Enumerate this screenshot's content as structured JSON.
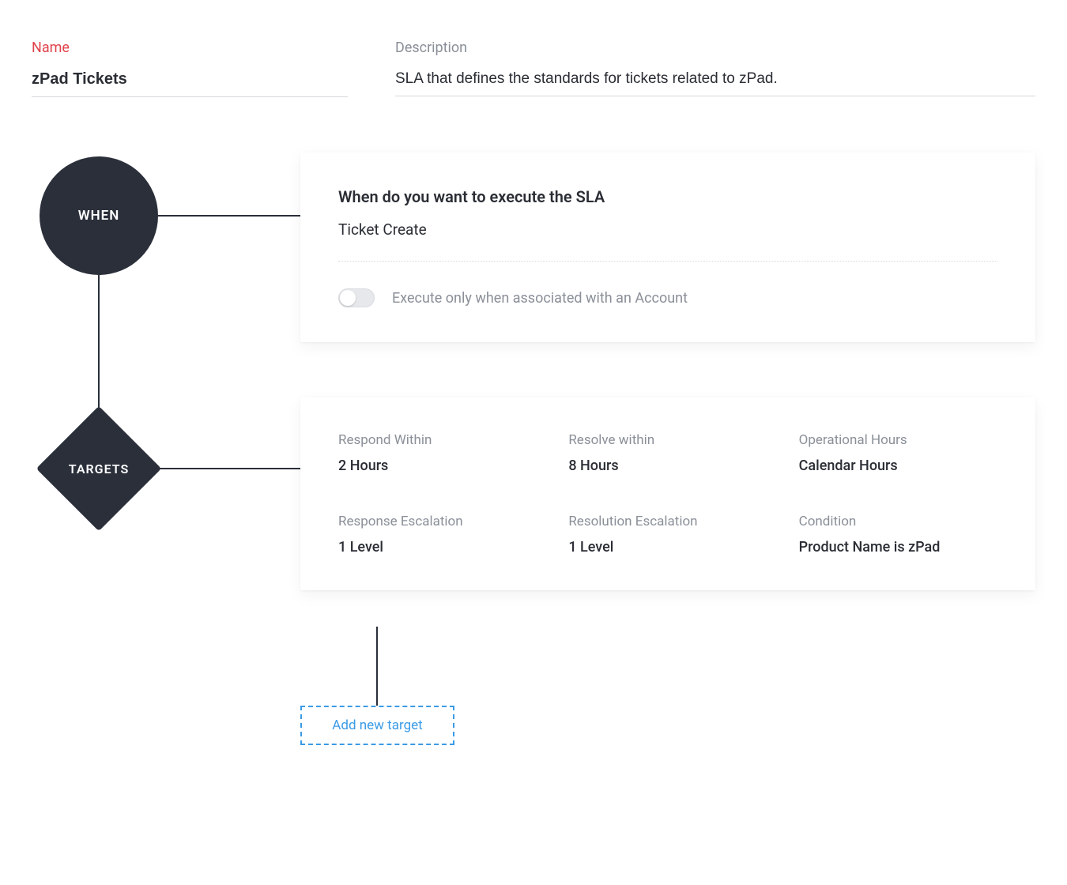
{
  "header": {
    "name_label": "Name",
    "name_value": "zPad Tickets",
    "description_label": "Description",
    "description_value": "SLA that defines the standards for tickets related to zPad."
  },
  "nodes": {
    "when_label": "WHEN",
    "targets_label": "TARGETS"
  },
  "when_card": {
    "title": "When do you want to execute the SLA",
    "trigger": "Ticket Create",
    "toggle_label": "Execute only when associated with an Account",
    "toggle_on": false
  },
  "targets_card": {
    "items": [
      {
        "label": "Respond Within",
        "value": "2 Hours"
      },
      {
        "label": "Resolve within",
        "value": "8 Hours"
      },
      {
        "label": "Operational Hours",
        "value": "Calendar Hours"
      },
      {
        "label": "Response Escalation",
        "value": "1 Level"
      },
      {
        "label": "Resolution Escalation",
        "value": "1 Level"
      },
      {
        "label": "Condition",
        "value": "Product Name is zPad"
      }
    ]
  },
  "add_target_label": "Add new target"
}
